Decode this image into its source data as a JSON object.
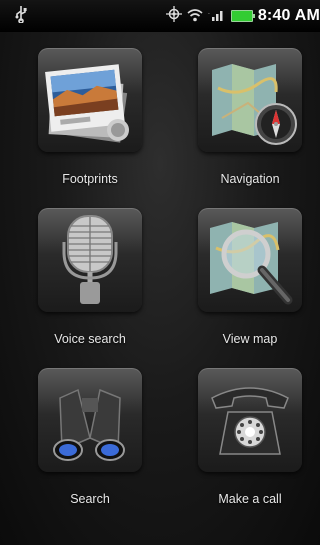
{
  "status_bar": {
    "time": "8:40 AM",
    "icons": [
      "usb-icon",
      "gps-icon",
      "wifi-icon",
      "signal-icon",
      "battery-icon"
    ]
  },
  "apps": [
    {
      "label": "Footprints",
      "icon": "photo-stack-icon"
    },
    {
      "label": "Navigation",
      "icon": "map-compass-icon"
    },
    {
      "label": "Voice search",
      "icon": "microphone-icon"
    },
    {
      "label": "View map",
      "icon": "map-magnifier-icon"
    },
    {
      "label": "Search",
      "icon": "binoculars-icon"
    },
    {
      "label": "Make a call",
      "icon": "telephone-icon"
    }
  ],
  "colors": {
    "background": "#1a1a1a",
    "label": "#e8e8e8",
    "battery": "#33cc33"
  }
}
